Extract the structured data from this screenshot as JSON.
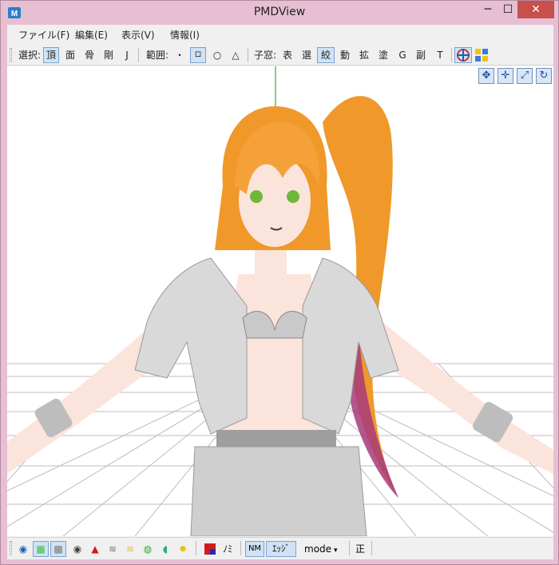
{
  "window": {
    "title": "PMDView",
    "min_glyph": "─",
    "max_glyph": "☐",
    "close_glyph": "✕",
    "app_icon": "pmd-app-icon"
  },
  "menu": [
    "ファイル(F)",
    "編集(E)",
    "表示(V)",
    "情報(I)"
  ],
  "toolbar_top": {
    "select_label": "選択:",
    "select_items": [
      {
        "label": "頂",
        "selected": true
      },
      {
        "label": "面",
        "selected": false
      },
      {
        "label": "骨",
        "selected": false
      },
      {
        "label": "剛",
        "selected": false
      },
      {
        "label": "J",
        "selected": false
      }
    ],
    "range_label": "範囲:",
    "range_items": [
      {
        "label": "・",
        "selected": false
      },
      {
        "label": "ロ",
        "selected": true
      },
      {
        "label": "○",
        "selected": false
      },
      {
        "label": "△",
        "selected": false
      }
    ],
    "subwindow_label": "子窓:",
    "subwindow_items": [
      {
        "label": "表",
        "selected": false
      },
      {
        "label": "選",
        "selected": false
      },
      {
        "label": "絞",
        "selected": true
      },
      {
        "label": "動",
        "selected": false
      },
      {
        "label": "拡",
        "selected": false
      },
      {
        "label": "塗",
        "selected": false
      },
      {
        "label": "G",
        "selected": false
      },
      {
        "label": "副",
        "selected": false
      },
      {
        "label": "T",
        "selected": false
      }
    ]
  },
  "viewport_controls": [
    "move-view-icon",
    "pan-icon",
    "zoom-icon",
    "rotate-icon"
  ],
  "toolbar_bottom": {
    "noMi_label": "ﾉﾐ",
    "nm_label": "NM",
    "edge_label": "ｴｯｼﾞ",
    "mode_label": "mode",
    "sho_label": "正"
  },
  "colors": {
    "window_frame": "#e7bfd2",
    "close_button": "#c7504d",
    "hair": "#f0982a",
    "hair_tip": "#a83a7a",
    "jacket": "#d9d9d9",
    "skin": "#fbe4dc",
    "ground_axis": "#2a8a2a"
  }
}
